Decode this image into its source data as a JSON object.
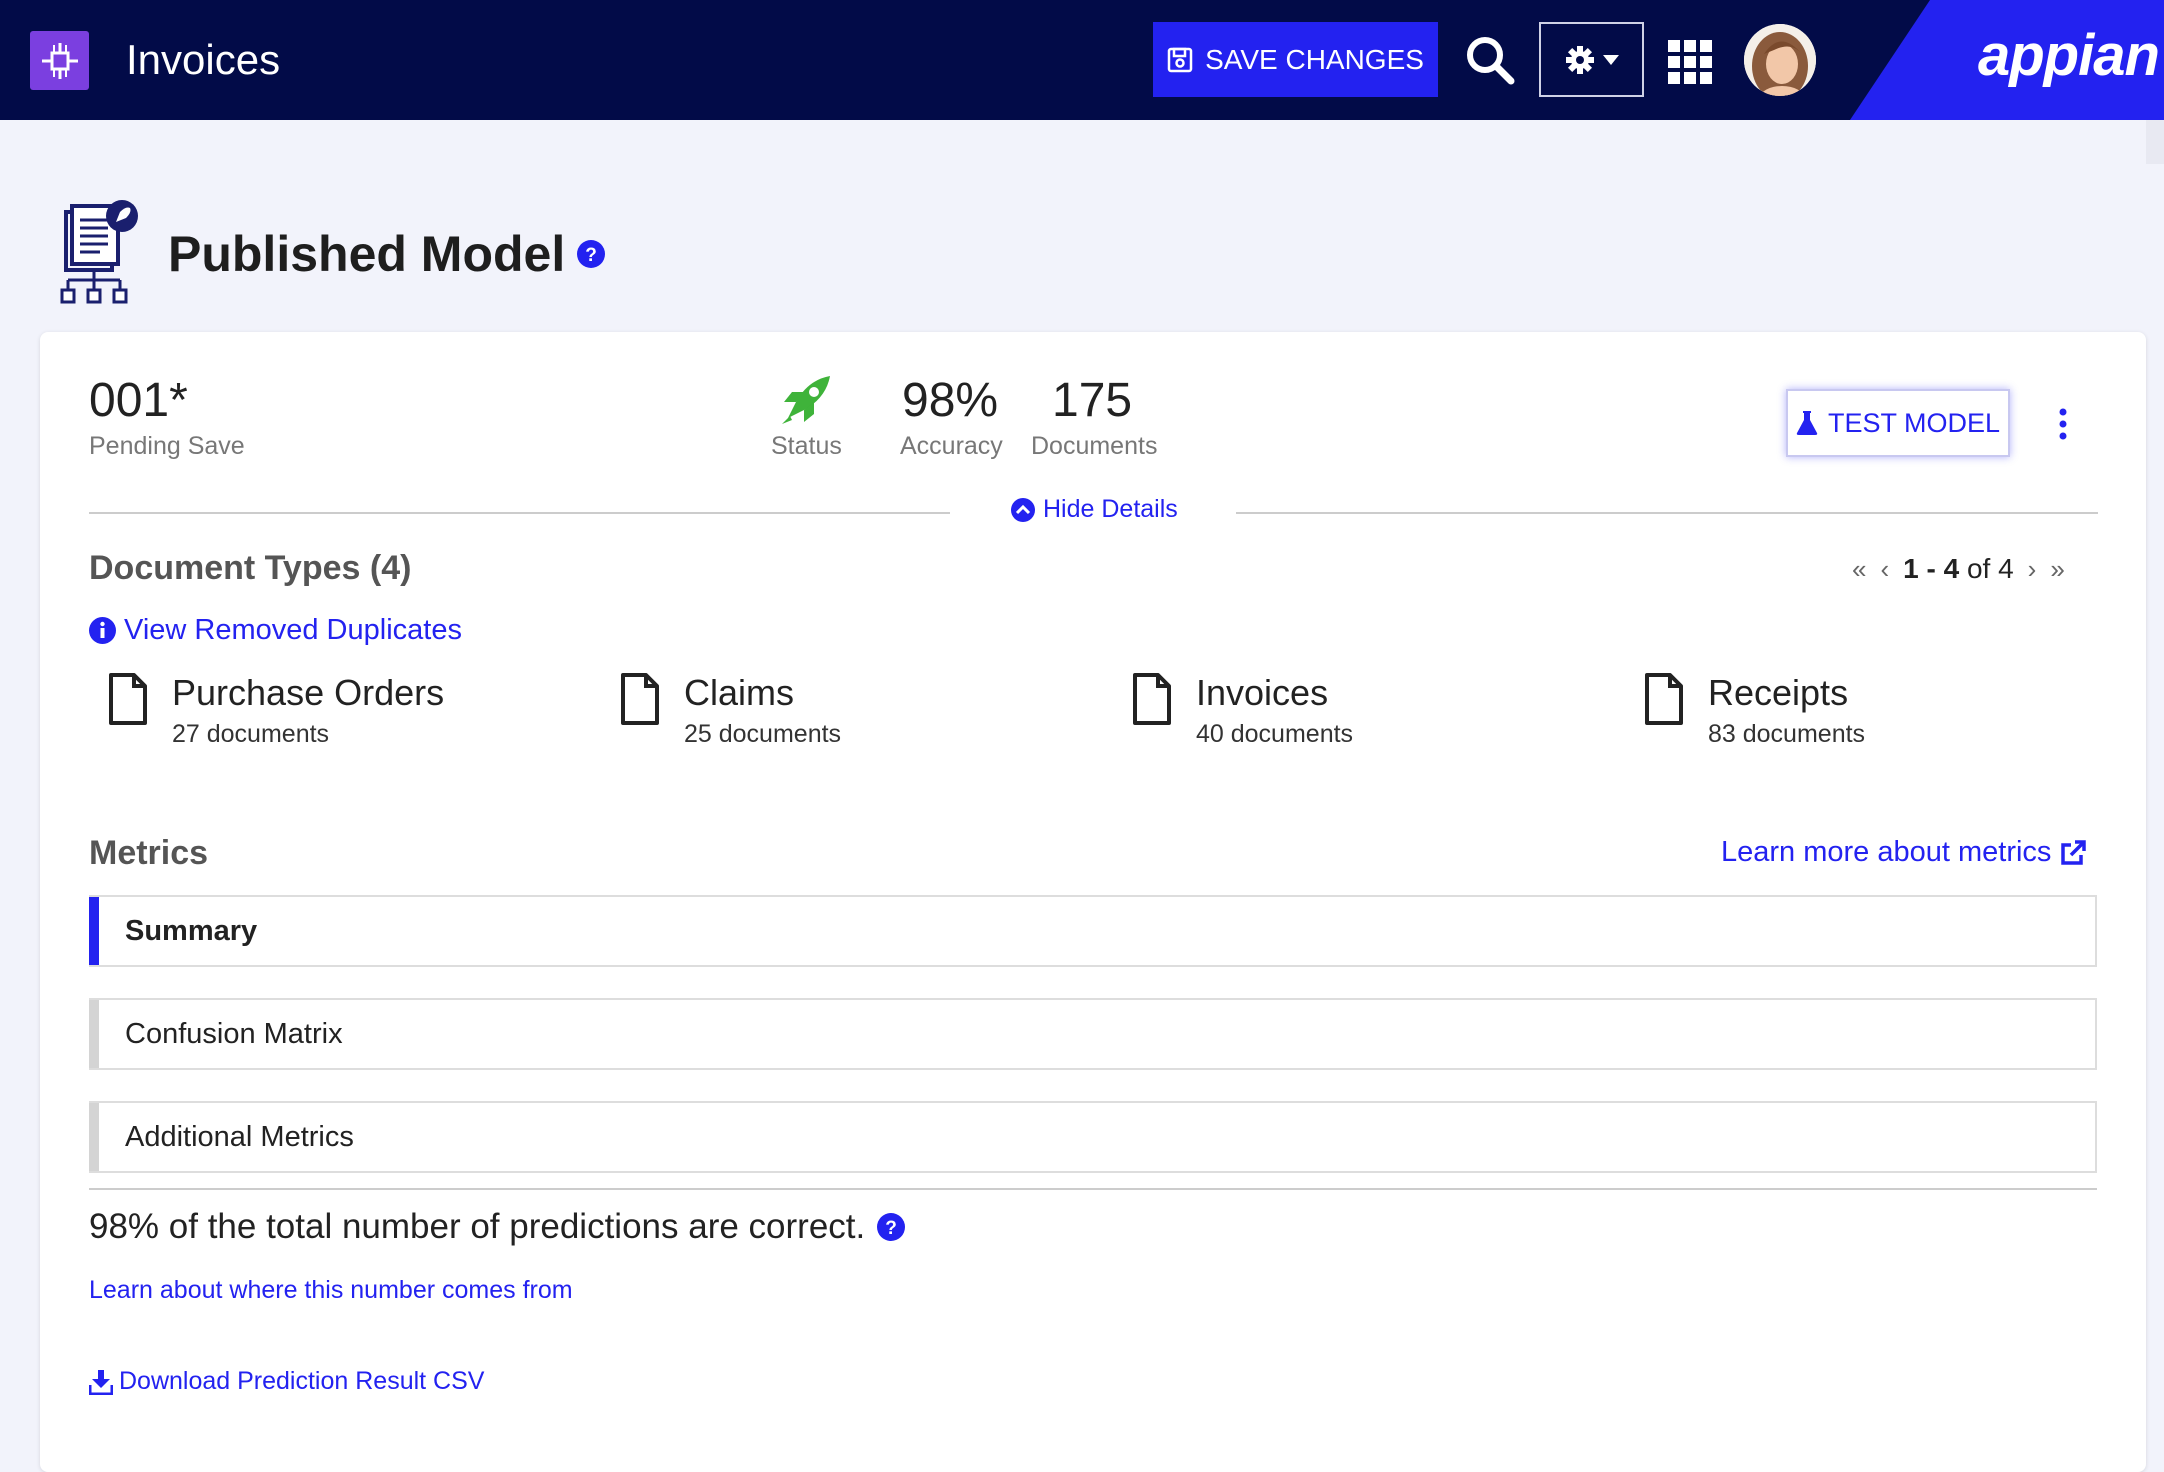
{
  "header": {
    "app_title": "Invoices",
    "save_label": "SAVE CHANGES",
    "brand": "appian"
  },
  "page": {
    "title": "Published Model"
  },
  "model": {
    "version": "001*",
    "version_status": "Pending Save",
    "status_label": "Status",
    "accuracy_value": "98%",
    "accuracy_label": "Accuracy",
    "documents_value": "175",
    "documents_label": "Documents",
    "test_model_label": "TEST MODEL",
    "hide_details_label": "Hide Details"
  },
  "document_types": {
    "title": "Document Types (4)",
    "view_duplicates_label": "View Removed Duplicates",
    "pager": {
      "range": "1 - 4",
      "of_text": "of 4"
    },
    "items": [
      {
        "name": "Purchase Orders",
        "count": "27 documents"
      },
      {
        "name": "Claims",
        "count": "25 documents"
      },
      {
        "name": "Invoices",
        "count": "40 documents"
      },
      {
        "name": "Receipts",
        "count": "83 documents"
      }
    ]
  },
  "metrics": {
    "title": "Metrics",
    "learn_more_label": "Learn more about metrics",
    "sections": [
      {
        "label": "Summary",
        "selected": true
      },
      {
        "label": "Confusion Matrix",
        "selected": false
      },
      {
        "label": "Additional Metrics",
        "selected": false
      }
    ],
    "summary_text": "98% of the total number of predictions are correct.",
    "learn_where_label": "Learn about where this number comes from",
    "download_label": "Download Prediction Result CSV"
  },
  "colors": {
    "header_bg": "#020b48",
    "accent": "#2322f0",
    "app_icon": "#7b3fe0",
    "status_green": "#3fb33a"
  }
}
